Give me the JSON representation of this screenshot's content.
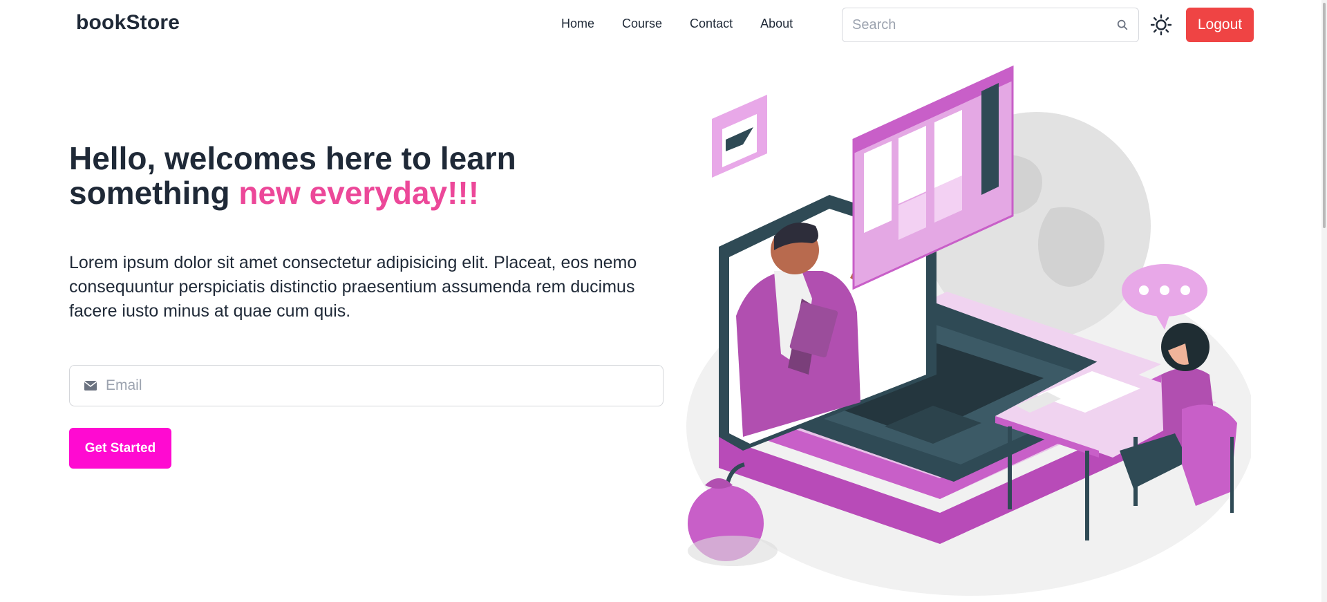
{
  "brand": "bookStore",
  "nav": {
    "links": [
      "Home",
      "Course",
      "Contact",
      "About"
    ],
    "search_placeholder": "Search",
    "logout_label": "Logout"
  },
  "hero": {
    "title_part1": "Hello, welcomes here to learn something",
    "title_accent": "new everyday!!!",
    "description": "Lorem ipsum dolor sit amet consectetur adipisicing elit. Placeat, eos nemo consequuntur perspiciatis distinctio praesentium assumenda rem ducimus facere iusto minus at quae cum quis.",
    "email_placeholder": "Email",
    "cta_label": "Get Started"
  },
  "icons": {
    "search": "search-icon",
    "theme": "sun-icon",
    "email": "envelope-icon"
  },
  "colors": {
    "accent_text": "#ec4899",
    "logout_bg": "#ef4444",
    "cta_bg": "#ff0ad1",
    "illustration_purple": "#c75fc8"
  }
}
